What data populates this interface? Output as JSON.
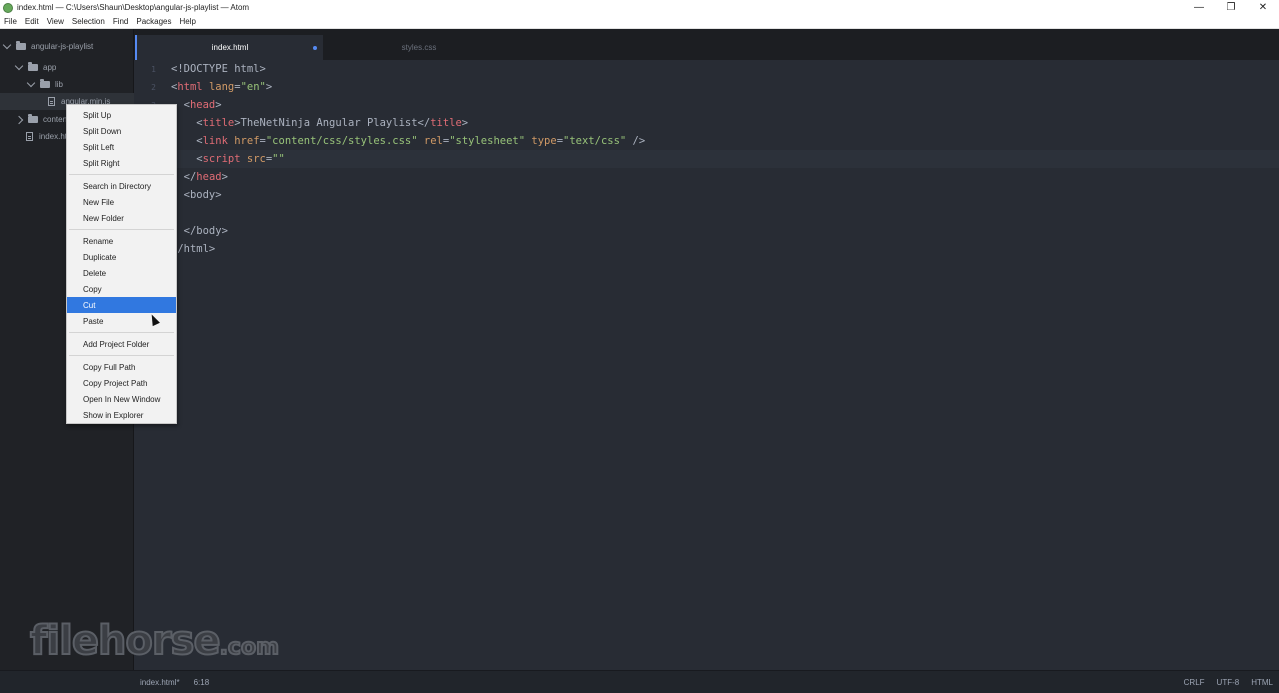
{
  "window": {
    "title": "index.html — C:\\Users\\Shaun\\Desktop\\angular-js-playlist — Atom",
    "controls": [
      "—",
      "❐",
      "✕"
    ]
  },
  "menubar": [
    "File",
    "Edit",
    "View",
    "Selection",
    "Find",
    "Packages",
    "Help"
  ],
  "tree": {
    "project": "angular-js-playlist",
    "items": [
      {
        "label": "app",
        "kind": "folder",
        "expanded": true
      },
      {
        "label": "lib",
        "kind": "folder",
        "expanded": true
      },
      {
        "label": "angular.min.js",
        "kind": "file",
        "selected": true
      },
      {
        "label": "content",
        "kind": "folder",
        "expanded": false
      },
      {
        "label": "index.html",
        "kind": "file"
      }
    ]
  },
  "tabs": [
    {
      "label": "index.html",
      "active": true,
      "modified": true
    },
    {
      "label": "styles.css",
      "active": false,
      "modified": false
    }
  ],
  "editor": {
    "line_numbers": [
      "1",
      "2",
      "3"
    ]
  },
  "context_menu": {
    "items": [
      "Split Up",
      "Split Down",
      "Split Left",
      "Split Right",
      "Search in Directory",
      "New File",
      "New Folder",
      "Rename",
      "Duplicate",
      "Delete",
      "Copy",
      "Cut",
      "Paste",
      "Add Project Folder",
      "Copy Full Path",
      "Copy Project Path",
      "Open In New Window",
      "Show in Explorer"
    ],
    "highlighted": "Cut"
  },
  "statusbar": {
    "file": "index.html*",
    "cursor": "6:18",
    "line_ending": "CRLF",
    "encoding": "UTF-8",
    "grammar": "HTML"
  },
  "watermark": {
    "text": "filehorse",
    "suffix": ".com"
  },
  "colors": {
    "accent": "#568af2",
    "menu_highlight": "#3178e0",
    "tag": "#e06c75",
    "attribute": "#d19a66",
    "string": "#98c379"
  }
}
